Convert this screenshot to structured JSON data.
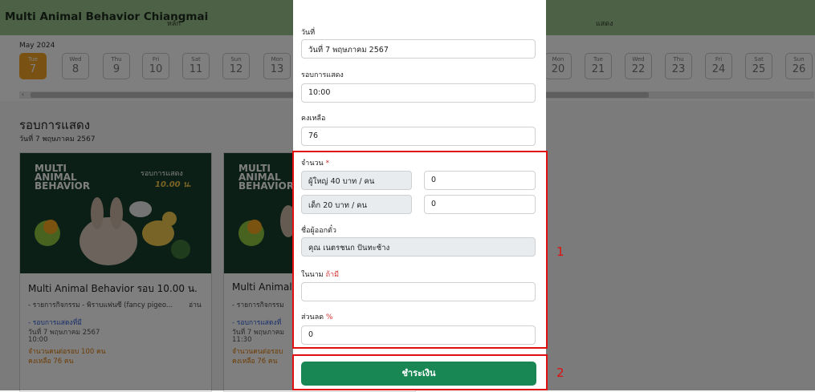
{
  "app": {
    "title": "Multi Animal Behavior Chiangmai"
  },
  "nav": [
    {
      "label": "หลัก"
    },
    {
      "label": "แสดง"
    }
  ],
  "dates": {
    "month": "May 2024",
    "days": [
      {
        "name": "Tue",
        "num": "7",
        "active": true
      },
      {
        "name": "Wed",
        "num": "8"
      },
      {
        "name": "Thu",
        "num": "9"
      },
      {
        "name": "Fri",
        "num": "10"
      },
      {
        "name": "Sat",
        "num": "11"
      },
      {
        "name": "Sun",
        "num": "12"
      },
      {
        "name": "Mon",
        "num": "13"
      },
      {
        "name": "Mon",
        "num": "20"
      },
      {
        "name": "Tue",
        "num": "21"
      },
      {
        "name": "Wed",
        "num": "22"
      },
      {
        "name": "Thu",
        "num": "23"
      },
      {
        "name": "Fri",
        "num": "24"
      },
      {
        "name": "Sat",
        "num": "25"
      },
      {
        "name": "Sun",
        "num": "26"
      }
    ],
    "scroll_left": "‹"
  },
  "section": {
    "title": "รอบการแสดง",
    "date": "วันที่ 7 พฤษภาคม 2567"
  },
  "cards": [
    {
      "poster": {
        "line1": "MULTI",
        "line2": "ANIMAL",
        "line3": "BEHAVIOR",
        "round_label": "รอบการแสดง",
        "time": "10.00 น."
      },
      "title": "Multi Animal Behavior รอบ 10.00 น.",
      "desc": "- รายการกิจกรรม - พิราบแฟนซี (fancy pigeo...",
      "more": "อ่าน",
      "link": "- รอบการแสดงที่มี",
      "date": "วันที่ 7 พฤษภาคม 2567",
      "time": "10:00",
      "capacity": "จำนวนคนต่อรอบ 100 คน",
      "remain": "คงเหลือ 76 คน"
    },
    {
      "poster": {
        "line1": "MULTI",
        "line2": "ANIMAL",
        "line3": "BEHAVIOR"
      },
      "title": "Multi Animal",
      "desc": "- รายการกิจกรรม",
      "link": "- รอบการแสดงที่",
      "date": "วันที่ 7 พฤษภาคม",
      "time": "11:30",
      "capacity": "จำนวนคนต่อรอบ",
      "remain": "คงเหลือ 76 คน"
    }
  ],
  "modal": {
    "date_label": "วันที่",
    "date_value": "วันที่ 7 พฤษภาคม 2567",
    "round_label": "รอบการแสดง",
    "round_value": "10:00",
    "remain_label": "คงเหลือ",
    "remain_value": "76",
    "qty_label": "จำนวน",
    "required_mark": "*",
    "adult_label": "ผู้ใหญ่ 40 บาท / คน",
    "adult_value": "0",
    "child_label": "เด็ก 20 บาท / คน",
    "child_value": "0",
    "issuer_label": "ชื่อผู้ออกตั๋ว",
    "issuer_value": "คุณ เนตรชนก ปันทะช้าง",
    "onbehalf_label": "ในนาม",
    "onbehalf_hint": "ถ้ามี",
    "onbehalf_value": "",
    "discount_label": "ส่วนลด",
    "discount_unit": "%",
    "discount_value": "0",
    "pay_button": "ชำระเงิน"
  },
  "annotations": [
    "1",
    "2"
  ],
  "colors": {
    "header": "#9bc28d",
    "active_day": "#f3a325",
    "pay": "#198754",
    "highlight": "#e01010"
  }
}
